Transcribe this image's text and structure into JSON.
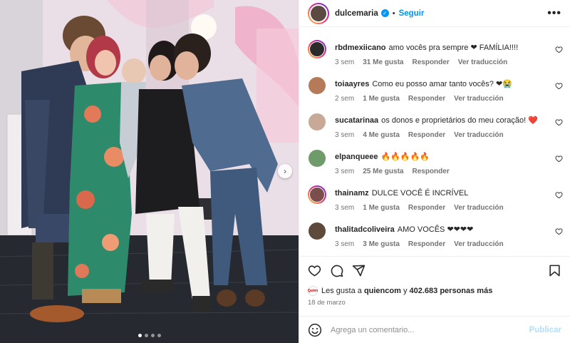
{
  "post": {
    "username": "dulcemaria",
    "follow_label": "Seguir",
    "separator": "•",
    "more_label": "•••",
    "carousel_next": "›",
    "photo_slide": "1 of 4"
  },
  "comments": [
    {
      "user": "rbdmexiicano",
      "text": "amo vocês pra sempre ❤ FAMÍLIA!!!!",
      "time": "3 sem",
      "likes": "31 Me gusta",
      "reply": "Responder",
      "translate": "Ver traducción",
      "avatar_color": "#2b2b2b",
      "ring": true
    },
    {
      "user": "toiaayres",
      "text": "Como eu posso amar tanto vocês? ❤😭",
      "time": "2 sem",
      "likes": "1 Me gusta",
      "reply": "Responder",
      "translate": "Ver traducción",
      "avatar_color": "#b57a58",
      "ring": false
    },
    {
      "user": "sucatarinaa",
      "text": "os donos e proprietários do meu coração! ❤️",
      "time": "3 sem",
      "likes": "4 Me gusta",
      "reply": "Responder",
      "translate": "Ver traducción",
      "avatar_color": "#c8a896",
      "ring": false
    },
    {
      "user": "elpanqueee",
      "text": "🔥🔥🔥🔥🔥",
      "time": "3 sem",
      "likes": "25 Me gusta",
      "reply": "Responder",
      "translate": "",
      "avatar_color": "#6f9a6a",
      "ring": false
    },
    {
      "user": "thainamz",
      "text": "DULCE VOCÊ É INCRÍVEL",
      "time": "3 sem",
      "likes": "1 Me gusta",
      "reply": "Responder",
      "translate": "Ver traducción",
      "avatar_color": "#7a4e4a",
      "ring": true
    },
    {
      "user": "thalitadcoliveira",
      "text": "AMO VOCÊS ❤❤❤❤",
      "time": "3 sem",
      "likes": "3 Me gusta",
      "reply": "Responder",
      "translate": "Ver traducción",
      "avatar_color": "#5d4a3a",
      "ring": false
    }
  ],
  "likes_line": {
    "prefix": "Les gusta a ",
    "user": "quiencom",
    "middle": " y ",
    "count": "402.683 personas más",
    "mini_logo": "Quién"
  },
  "date": "18 de marzo",
  "add_comment": {
    "placeholder": "Agrega un comentario...",
    "publish": "Publicar"
  },
  "colors": {
    "accent": "#0095f6",
    "muted": "#737373",
    "publish_disabled": "#b2dffc"
  }
}
